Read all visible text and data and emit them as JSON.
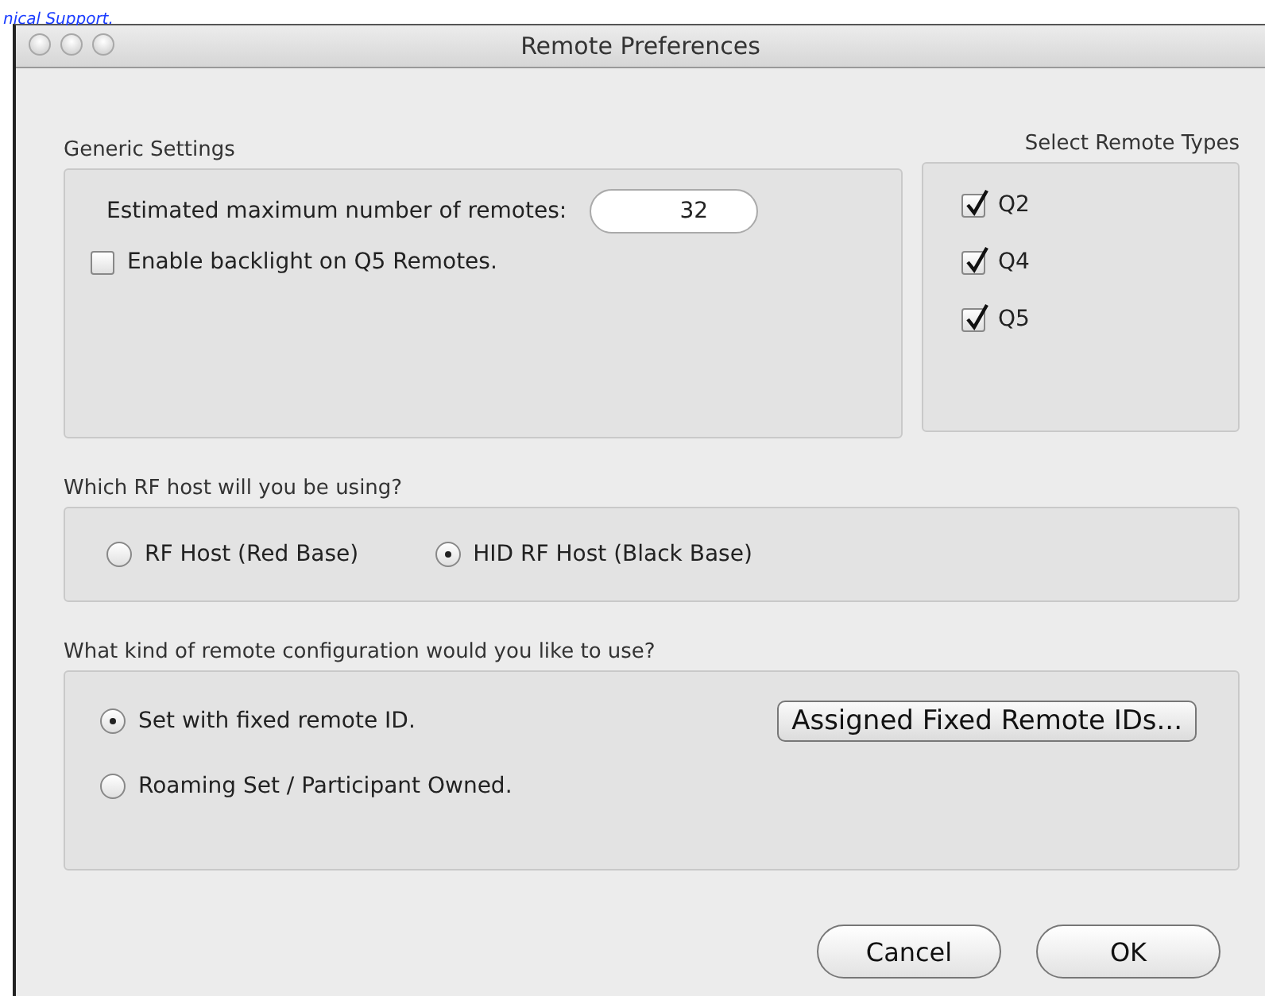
{
  "link_fragment": "nical Support.",
  "window": {
    "title": "Remote Preferences"
  },
  "generic_settings": {
    "title": "Generic Settings",
    "max_remotes_label": "Estimated maximum number of remotes:",
    "max_remotes_value": "32",
    "backlight": {
      "label": "Enable backlight on Q5 Remotes.",
      "checked": false
    }
  },
  "remote_types": {
    "title": "Select Remote Types",
    "items": [
      {
        "label": "Q2",
        "checked": true
      },
      {
        "label": "Q4",
        "checked": true
      },
      {
        "label": "Q5",
        "checked": true
      }
    ]
  },
  "rf_host": {
    "title": "Which RF host will you be using?",
    "options": [
      {
        "label": "RF Host (Red Base)",
        "selected": false
      },
      {
        "label": "HID RF Host (Black Base)",
        "selected": true
      }
    ]
  },
  "configuration": {
    "title": "What kind of remote configuration would you like to use?",
    "options": [
      {
        "label": "Set with fixed remote ID.",
        "selected": true
      },
      {
        "label": "Roaming Set / Participant Owned.",
        "selected": false
      }
    ],
    "button": "Assigned Fixed Remote IDs..."
  },
  "buttons": [
    "Cancel",
    "OK"
  ]
}
